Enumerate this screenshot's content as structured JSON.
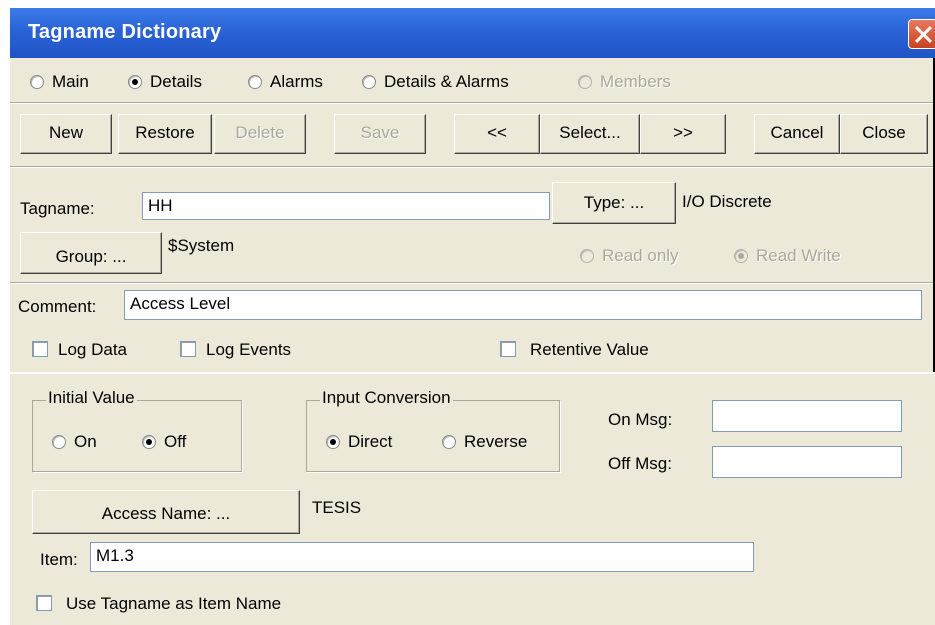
{
  "window": {
    "title": "Tagname Dictionary"
  },
  "view_options": [
    {
      "label": "Main",
      "selected": false,
      "enabled": true
    },
    {
      "label": "Details",
      "selected": true,
      "enabled": true
    },
    {
      "label": "Alarms",
      "selected": false,
      "enabled": true
    },
    {
      "label": "Details & Alarms",
      "selected": false,
      "enabled": true
    },
    {
      "label": "Members",
      "selected": false,
      "enabled": false
    }
  ],
  "toolbar": {
    "new": "New",
    "restore": "Restore",
    "delete": "Delete",
    "save": "Save",
    "prev": "<<",
    "select": "Select...",
    "next": ">>",
    "cancel": "Cancel",
    "close": "Close"
  },
  "tag": {
    "tagname_label": "Tagname:",
    "tagname_value": "HH",
    "type_button": "Type: ...",
    "type_value": "I/O Discrete",
    "group_button": "Group: ...",
    "group_value": "$System",
    "read_only": "Read only",
    "read_write": "Read Write",
    "access_mode": "Read Write",
    "comment_label": "Comment:",
    "comment_value": "Access Level",
    "log_data": "Log Data",
    "log_events": "Log Events",
    "retentive_value": "Retentive Value"
  },
  "details": {
    "initial_value_title": "Initial Value",
    "initial_on": "On",
    "initial_off": "Off",
    "initial_selected": "Off",
    "input_conversion_title": "Input Conversion",
    "direct": "Direct",
    "reverse": "Reverse",
    "conversion_selected": "Direct",
    "on_msg_label": "On Msg:",
    "on_msg_value": "",
    "off_msg_label": "Off Msg:",
    "off_msg_value": "",
    "access_name_button": "Access Name: ...",
    "access_name_value": "TESIS",
    "item_label": "Item:",
    "item_value": "M1.3",
    "use_tagname_label": "Use Tagname as Item Name"
  },
  "colors": {
    "titlebar": "#2a63d6",
    "dialog_face": "#ece9d8",
    "disabled_text": "#aca899",
    "close_button": "#c8431f"
  }
}
